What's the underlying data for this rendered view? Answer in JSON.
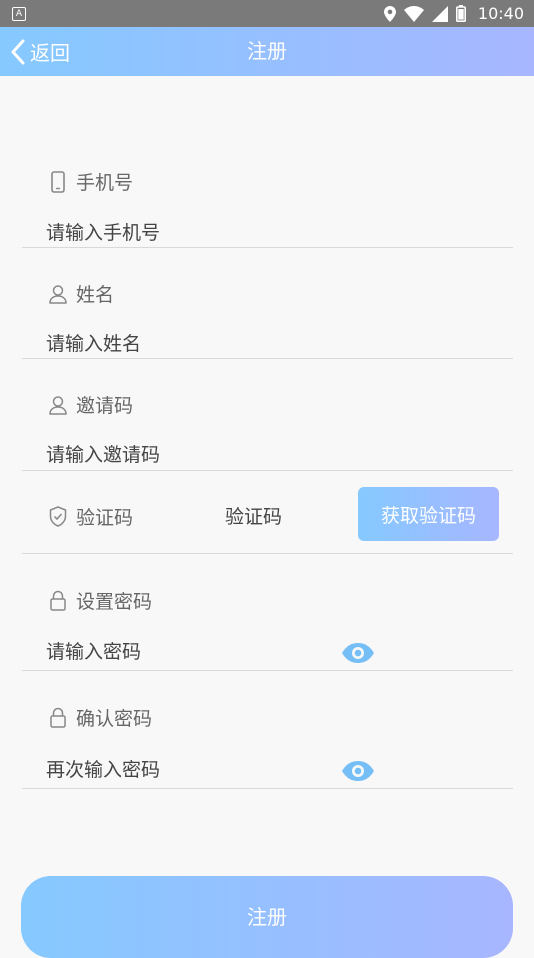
{
  "status_bar": {
    "app_badge": "A",
    "time": "10:40",
    "icons": [
      "location-icon",
      "wifi-icon",
      "signal-icon",
      "battery-icon"
    ]
  },
  "header": {
    "back_label": "返回",
    "title": "注册"
  },
  "form": {
    "phone": {
      "label": "手机号",
      "placeholder": "请输入手机号",
      "icon": "phone-icon"
    },
    "name": {
      "label": "姓名",
      "placeholder": "请输入姓名",
      "icon": "user-icon"
    },
    "invite": {
      "label": "邀请码",
      "placeholder": "请输入邀请码",
      "icon": "user-icon"
    },
    "code": {
      "label": "验证码",
      "placeholder": "验证码",
      "button_label": "获取验证码",
      "icon": "shield-icon"
    },
    "password": {
      "label": "设置密码",
      "placeholder": "请输入密码",
      "icon": "lock-icon"
    },
    "confirm": {
      "label": "确认密码",
      "placeholder": "再次输入密码",
      "icon": "lock-icon"
    }
  },
  "submit_label": "注册",
  "colors": {
    "gradient_start": "#85c9ff",
    "gradient_end": "#a7b6ff",
    "eye_icon": "#75bff6",
    "status_bar": "#7a7a7a"
  }
}
